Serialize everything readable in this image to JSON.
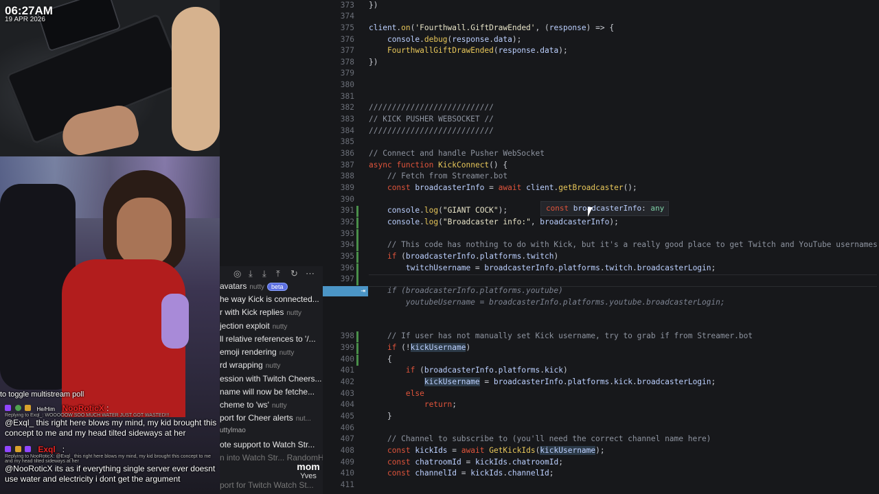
{
  "overlay": {
    "time": "06:27AM",
    "date": "19 APR 2026"
  },
  "chat": {
    "toggle_hint": "to toggle multistream poll",
    "messages": [
      {
        "pronoun": "He/Him",
        "user": "NooRoticX",
        "reply": "Replying to Exql_: WOOOOOW SOO MUCH WATER JUST GOT WASTED!!!",
        "text": "@Exql_ this right here blows my mind, my kid brought this concept to me and my head tilted sideways at her"
      },
      {
        "pronoun": "",
        "user": "Exql_",
        "reply": "Replying to NooRoticX: @Exql_ this right here blows my mind, my kid brought this concept to me and my head tilted sideways at her",
        "text": "@NooRoticX its as if everything single server ever doesnt use water and electricity i dont get the argument"
      }
    ]
  },
  "caption": {
    "title": "mom",
    "subtitle": "Yves"
  },
  "list_panel": {
    "rows": [
      {
        "title": "avatars",
        "author": "nutty",
        "badge": "beta"
      },
      {
        "title": "he way Kick is connected...",
        "author": ""
      },
      {
        "title": "r with Kick replies",
        "author": "nutty"
      },
      {
        "title": "jection exploit",
        "author": "nutty"
      },
      {
        "title": "ll relative references to '/...",
        "author": ""
      },
      {
        "title": "emoji rendering",
        "author": "nutty"
      },
      {
        "title": "rd wrapping",
        "author": "nutty"
      },
      {
        "title": "ession with Twitch Cheers...",
        "author": ""
      },
      {
        "title": "name will now be fetche...",
        "author": ""
      },
      {
        "title": "cheme to 'ws'",
        "author": "nutty"
      },
      {
        "title": "port for Cheer alerts",
        "author": "nut..."
      },
      {
        "title": "uttylmao",
        "author": ""
      },
      {
        "title": "ote support to Watch Str...",
        "author": ""
      },
      {
        "title": "n into Watch Str... RandomH...",
        "author": ""
      },
      {
        "title": "port for Twitch Watch St...",
        "author": ""
      }
    ]
  },
  "editor": {
    "tooltip": {
      "kw": "const",
      "name": "broadcasterInfo",
      "type": "any"
    },
    "ghost_tab_symbol": "⇥",
    "lines": [
      {
        "n": "373",
        "t": "})"
      },
      {
        "n": "374",
        "t": ""
      },
      {
        "n": "375",
        "t": "client.on('Fourthwall.GiftDrawEnded', (response) => {"
      },
      {
        "n": "376",
        "t": "    console.debug(response.data);"
      },
      {
        "n": "377",
        "t": "    FourthwallGiftDrawEnded(response.data);"
      },
      {
        "n": "378",
        "t": "})"
      },
      {
        "n": "379",
        "t": ""
      },
      {
        "n": "380",
        "t": ""
      },
      {
        "n": "381",
        "t": ""
      },
      {
        "n": "382",
        "t": "///////////////////////////"
      },
      {
        "n": "383",
        "t": "// KICK PUSHER WEBSOCKET //"
      },
      {
        "n": "384",
        "t": "///////////////////////////"
      },
      {
        "n": "385",
        "t": ""
      },
      {
        "n": "386",
        "t": "// Connect and handle Pusher WebSocket"
      },
      {
        "n": "387",
        "t": "async function KickConnect() {"
      },
      {
        "n": "388",
        "t": "    // Fetch from Streamer.bot"
      },
      {
        "n": "389",
        "t": "    const broadcasterInfo = await client.getBroadcaster();"
      },
      {
        "n": "390",
        "t": ""
      },
      {
        "n": "391",
        "t": "    console.log(\"GIANT COCK\");"
      },
      {
        "n": "392",
        "t": "    console.log(\"Broadcaster info:\", broadcasterInfo);"
      },
      {
        "n": "393",
        "t": ""
      },
      {
        "n": "394",
        "t": "    // This code has nothing to do with Kick, but it's a really good place to get Twitch and YouTube usernames"
      },
      {
        "n": "395",
        "t": "    if (broadcasterInfo.platforms.twitch)"
      },
      {
        "n": "396",
        "t": "        twitchUsername = broadcasterInfo.platforms.twitch.broadcasterLogin;"
      },
      {
        "n": "397",
        "t": ""
      },
      {
        "n": "",
        "t": "    if (broadcasterInfo.platforms.youtube)"
      },
      {
        "n": "",
        "t": "        youtubeUsername = broadcasterInfo.platforms.youtube.broadcasterLogin;"
      },
      {
        "n": "398",
        "t": "    // If user has not manually set Kick username, try to grab if from Streamer.bot"
      },
      {
        "n": "399",
        "t": "    if (!kickUsername)"
      },
      {
        "n": "400",
        "t": "    {"
      },
      {
        "n": "401",
        "t": "        if (broadcasterInfo.platforms.kick)"
      },
      {
        "n": "402",
        "t": "            kickUsername = broadcasterInfo.platforms.kick.broadcasterLogin;"
      },
      {
        "n": "403",
        "t": "        else"
      },
      {
        "n": "404",
        "t": "            return;"
      },
      {
        "n": "405",
        "t": "    }"
      },
      {
        "n": "406",
        "t": ""
      },
      {
        "n": "407",
        "t": "    // Channel to subscribe to (you'll need the correct channel name here)"
      },
      {
        "n": "408",
        "t": "    const kickIds = await GetKickIds(kickUsername);"
      },
      {
        "n": "409",
        "t": "    const chatroomId = kickIds.chatroomId;"
      },
      {
        "n": "410",
        "t": "    const channelId = kickIds.channelId;"
      },
      {
        "n": "411",
        "t": ""
      }
    ]
  },
  "colors": {
    "keyword": "#e0543b",
    "function": "#e8c75a",
    "identifier": "#bcd0ff",
    "comment": "#8e94a0",
    "ghost_tab": "#4b95c6",
    "chat_username": "#ee2222"
  },
  "icons": [
    "twitch-icon",
    "badge-icon",
    "settings-icon",
    "download-icon",
    "upload-icon",
    "refresh-icon",
    "more-icon"
  ]
}
